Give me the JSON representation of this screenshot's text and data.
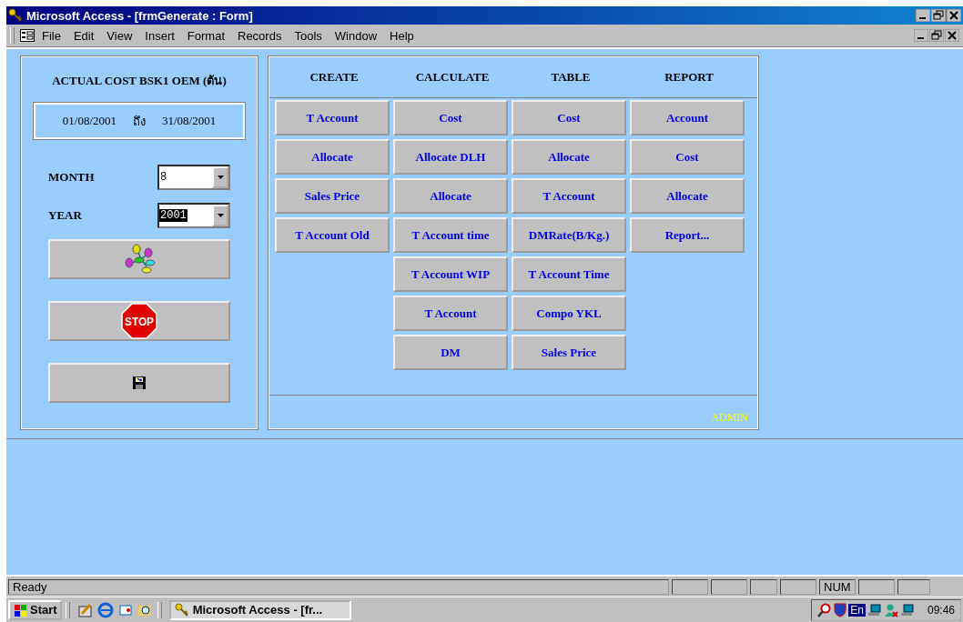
{
  "window": {
    "title": "Microsoft Access - [frmGenerate : Form]"
  },
  "menu": [
    "File",
    "Edit",
    "View",
    "Insert",
    "Format",
    "Records",
    "Tools",
    "Window",
    "Help"
  ],
  "left_panel": {
    "title": "ACTUAL COST BSK1 OEM (ตัน)",
    "date_from": "01/08/2001",
    "date_sep": "ถึง",
    "date_to": "31/08/2001",
    "fields": [
      {
        "label": "MONTH",
        "value": "8",
        "selected": false
      },
      {
        "label": "YEAR",
        "value": "2001",
        "selected": true
      }
    ],
    "buttons": [
      {
        "kind": "network"
      },
      {
        "kind": "stop",
        "label": "STOP"
      },
      {
        "kind": "save"
      }
    ]
  },
  "button_columns": [
    {
      "heading": "CREATE",
      "buttons": [
        "T Account",
        "Allocate",
        "Sales Price",
        "T Account Old"
      ]
    },
    {
      "heading": "CALCULATE",
      "buttons": [
        "Cost",
        "Allocate DLH",
        "Allocate",
        "T Account time",
        "T Account WIP",
        "T Account",
        "DM"
      ]
    },
    {
      "heading": "TABLE",
      "buttons": [
        "Cost",
        "Allocate",
        "T Account",
        "DMRate(B/Kg.)",
        "T Account Time",
        "Compo YKL",
        "Sales Price"
      ]
    },
    {
      "heading": "REPORT",
      "buttons": [
        "Account",
        "Cost",
        "Allocate",
        "Report..."
      ]
    }
  ],
  "footer_user": "ADMIN",
  "status_bar": {
    "text": "Ready",
    "indicator": "NUM"
  },
  "taskbar": {
    "start": "Start",
    "task": "Microsoft Access - [fr...",
    "language": "En",
    "clock": "09:46"
  }
}
